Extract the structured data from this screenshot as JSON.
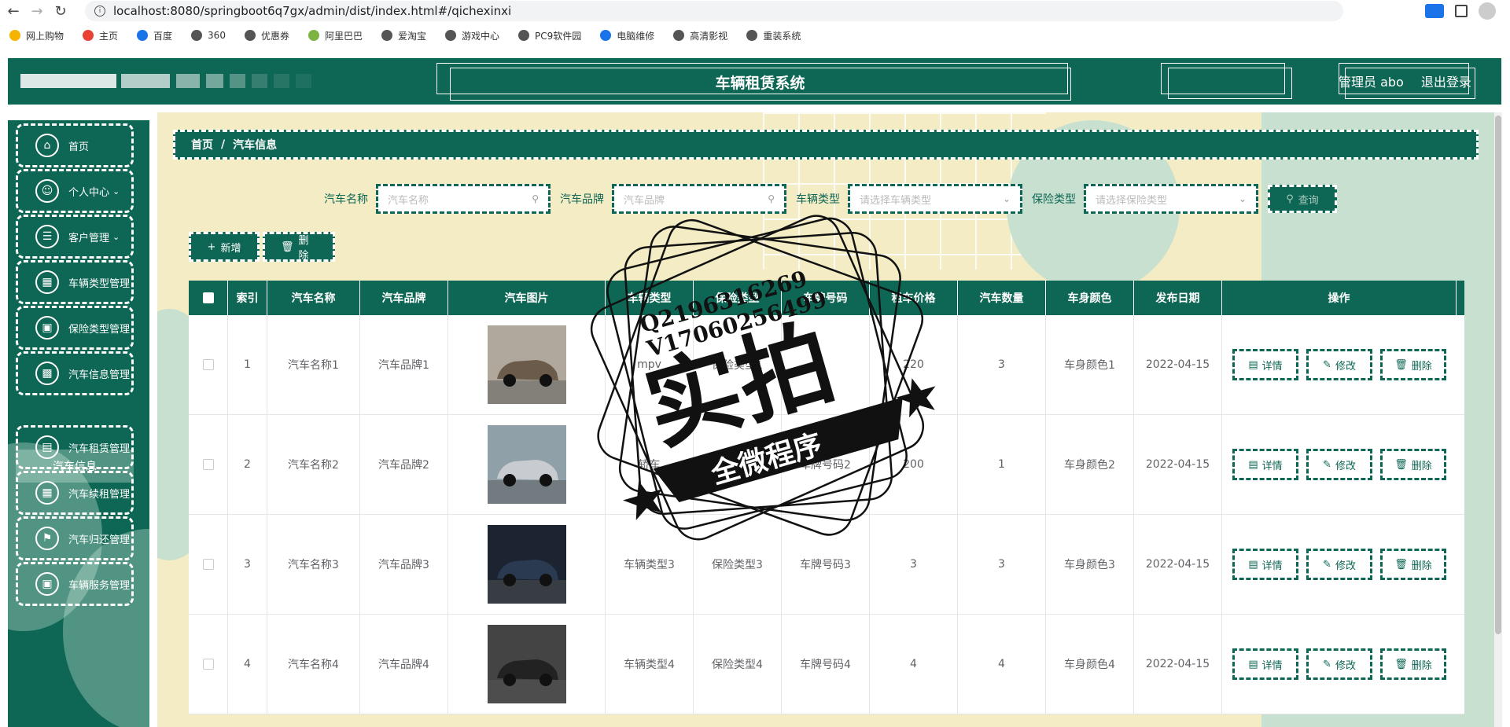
{
  "browser": {
    "url": "localhost:8080/springboot6q7gx/admin/dist/index.html#/qichexinxi",
    "bookmarks": [
      "网上购物",
      "主页",
      "百度",
      "360",
      "优惠券",
      "阿里巴巴",
      "爱淘宝",
      "游戏中心",
      "PC9软件园",
      "电脑维修",
      "高清影视",
      "重装系统"
    ]
  },
  "header": {
    "title": "车辆租赁系统",
    "user": "管理员 abo",
    "logout": "退出登录"
  },
  "sidebar": {
    "items": [
      {
        "label": "首页",
        "icon": "home-icon"
      },
      {
        "label": "个人中心",
        "icon": "user-icon"
      },
      {
        "label": "客户管理",
        "icon": "list-icon"
      },
      {
        "label": "车辆类型管理",
        "icon": "car-type-icon"
      },
      {
        "label": "保险类型管理",
        "icon": "insurance-icon"
      },
      {
        "label": "汽车信息管理",
        "icon": "chart-icon"
      },
      {
        "label": "汽车租赁管理",
        "icon": "rent-icon"
      },
      {
        "label": "汽车续租管理",
        "icon": "grid-icon"
      },
      {
        "label": "汽车归还管理",
        "icon": "flag-icon"
      },
      {
        "label": "车辆服务管理",
        "icon": "service-icon"
      }
    ],
    "active_sub": "汽车信息"
  },
  "breadcrumb": {
    "home": "首页",
    "sep": "/",
    "current": "汽车信息"
  },
  "search": {
    "name_label": "汽车名称",
    "name_placeholder": "汽车名称",
    "brand_label": "汽车品牌",
    "brand_placeholder": "汽车品牌",
    "type_label": "车辆类型",
    "type_placeholder": "请选择车辆类型",
    "ins_label": "保险类型",
    "ins_placeholder": "请选择保险类型",
    "query": "查询"
  },
  "actions": {
    "add": "新增",
    "delete": "删除"
  },
  "table": {
    "headers": [
      "索引",
      "汽车名称",
      "汽车品牌",
      "汽车图片",
      "车辆类型",
      "保险类型",
      "车牌号码",
      "租车价格",
      "汽车数量",
      "车身颜色",
      "发布日期",
      "操作"
    ],
    "rows": [
      {
        "idx": "1",
        "name": "汽车名称1",
        "brand": "汽车品牌1",
        "type": "mpv",
        "ins": "保险类型1",
        "plate": "",
        "price": "220",
        "qty": "3",
        "color": "车身颜色1",
        "date": "2022-04-15"
      },
      {
        "idx": "2",
        "name": "汽车名称2",
        "brand": "汽车品牌2",
        "type": "轿车",
        "ins": "",
        "plate": "车牌号码2",
        "price": "200",
        "qty": "1",
        "color": "车身颜色2",
        "date": "2022-04-15"
      },
      {
        "idx": "3",
        "name": "汽车名称3",
        "brand": "汽车品牌3",
        "type": "车辆类型3",
        "ins": "保险类型3",
        "plate": "车牌号码3",
        "price": "3",
        "qty": "3",
        "color": "车身颜色3",
        "date": "2022-04-15"
      },
      {
        "idx": "4",
        "name": "汽车名称4",
        "brand": "汽车品牌4",
        "type": "车辆类型4",
        "ins": "保险类型4",
        "plate": "车牌号码4",
        "price": "4",
        "qty": "4",
        "color": "车身颜色4",
        "date": "2022-04-15"
      }
    ],
    "op_detail": "详情",
    "op_edit": "修改",
    "op_delete": "删除"
  },
  "watermark": {
    "line1": "Q2196316269",
    "line2": "V17060256499",
    "big": "实拍",
    "banner": "全微程序"
  },
  "colors": {
    "primary": "#0e6654",
    "bg_cream": "#f3ecc4",
    "bg_mint": "#c8e0cf"
  }
}
